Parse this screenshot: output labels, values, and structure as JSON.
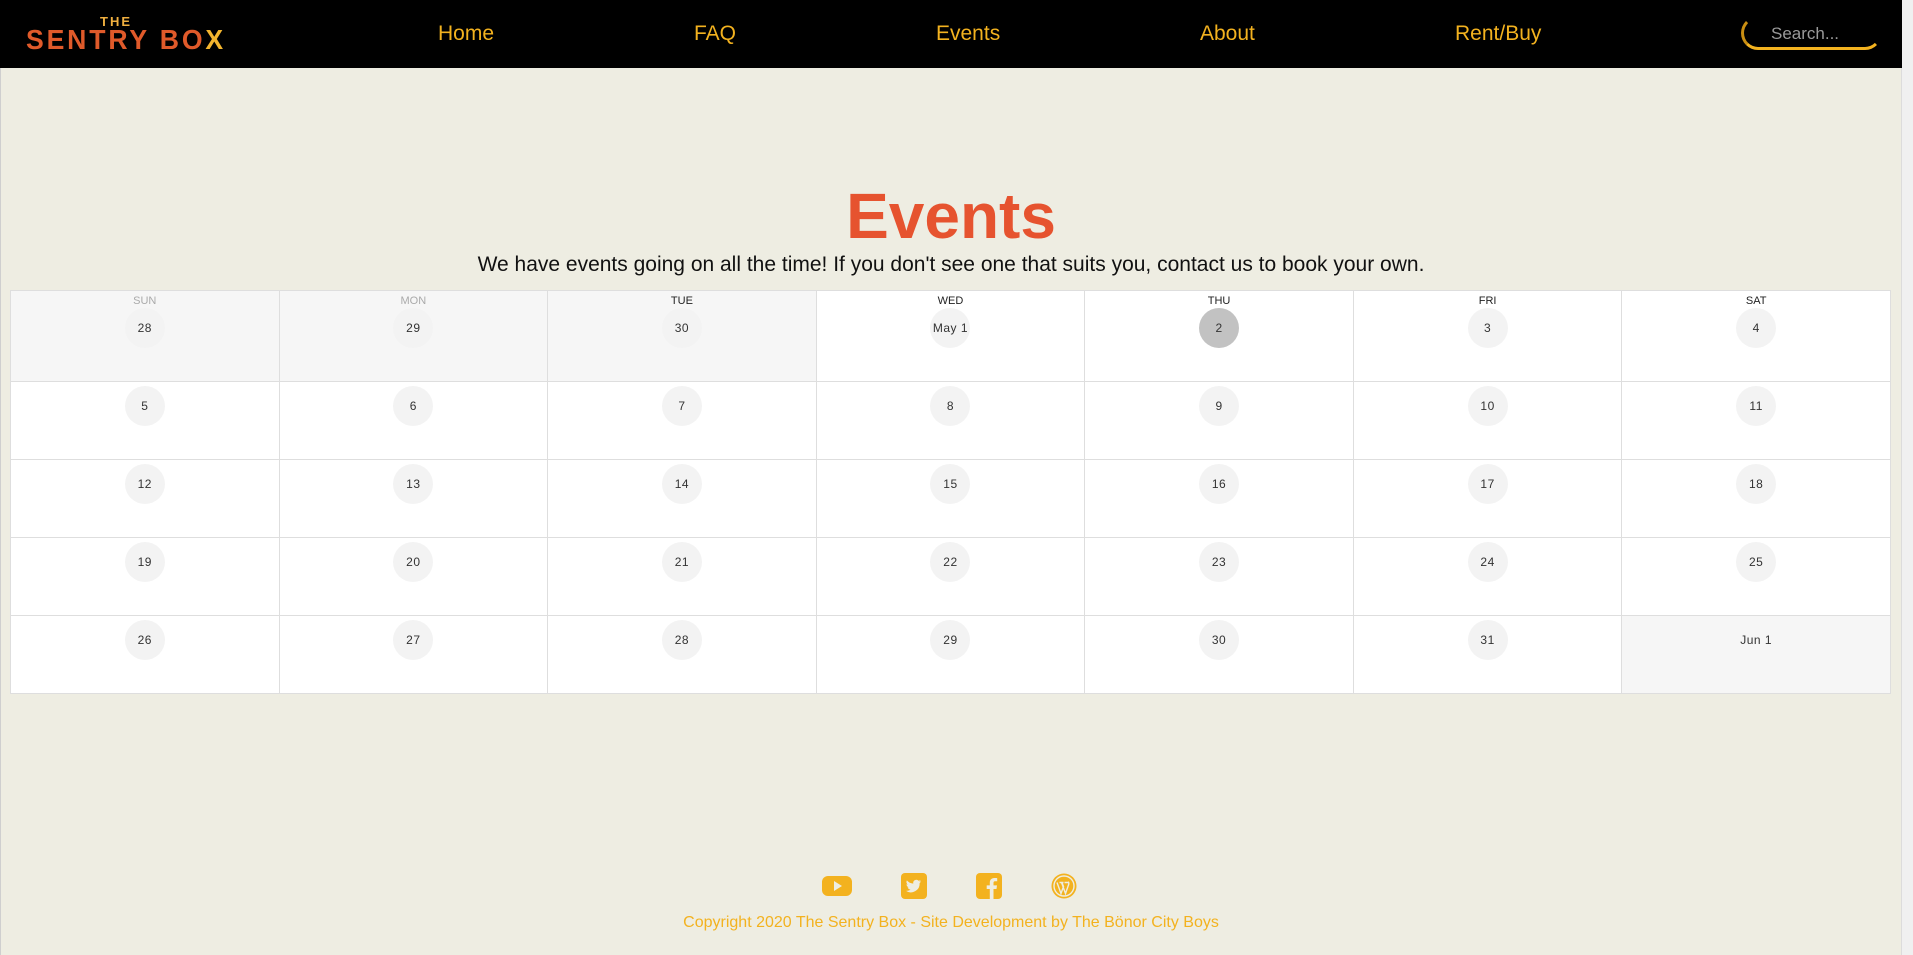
{
  "brand": {
    "logo_top": "THE",
    "logo_main": "SENTRY BO",
    "logo_x": "X"
  },
  "nav": {
    "items": [
      {
        "label": "Home"
      },
      {
        "label": "FAQ"
      },
      {
        "label": "Events"
      },
      {
        "label": "About"
      },
      {
        "label": "Rent/Buy"
      }
    ]
  },
  "search": {
    "placeholder": "Search...",
    "value": ""
  },
  "main": {
    "title": "Events",
    "subtitle": "We have events going on all the time! If you don't see one that suits you, contact us to book your own."
  },
  "calendar": {
    "weekdays": [
      "SUN",
      "MON",
      "TUE",
      "WED",
      "THU",
      "FRI",
      "SAT"
    ],
    "today": "2",
    "weeks": [
      [
        "28",
        "29",
        "30",
        "May 1",
        "2",
        "3",
        "4"
      ],
      [
        "5",
        "6",
        "7",
        "8",
        "9",
        "10",
        "11"
      ],
      [
        "12",
        "13",
        "14",
        "15",
        "16",
        "17",
        "18"
      ],
      [
        "19",
        "20",
        "21",
        "22",
        "23",
        "24",
        "25"
      ],
      [
        "26",
        "27",
        "28",
        "29",
        "30",
        "31",
        "Jun 1"
      ]
    ]
  },
  "footer": {
    "icons": [
      "youtube-icon",
      "twitter-icon",
      "facebook-icon",
      "wordpress-icon"
    ],
    "icon_color": "#f3b21f",
    "copyright": "Copyright 2020 The Sentry Box - Site Development by The Bönor City Boys"
  },
  "colors": {
    "accent": "#f3b21f",
    "title": "#e6532f",
    "background": "#eeede2"
  }
}
